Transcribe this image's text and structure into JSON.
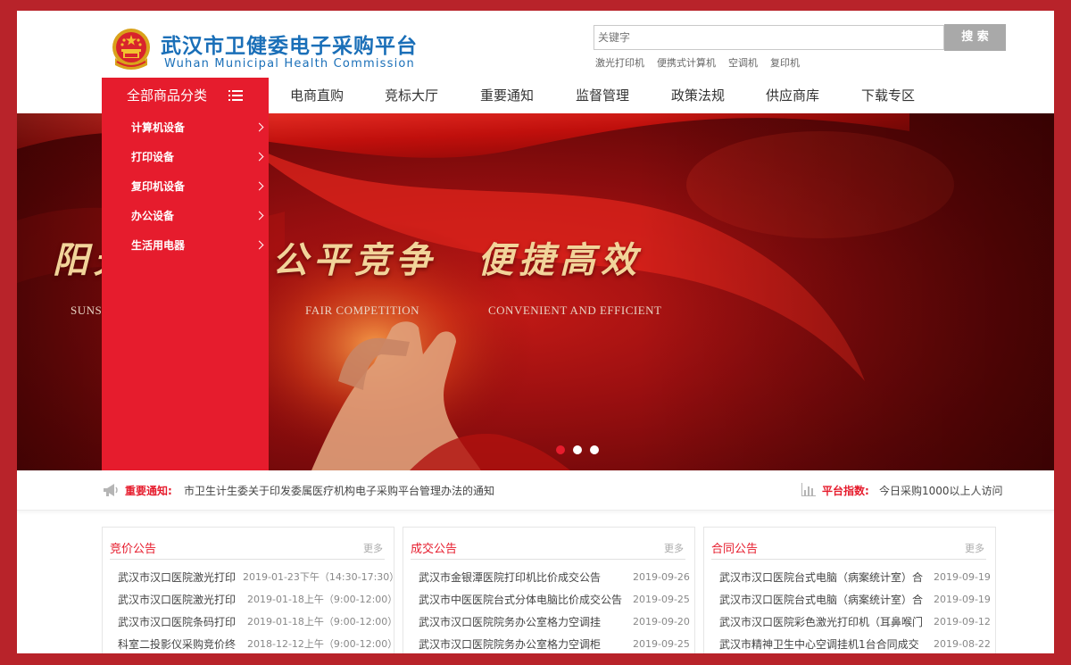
{
  "header": {
    "site_title": "武汉市卫健委电子采购平台",
    "site_subtitle": "Wuhan Municipal Health Commission",
    "search_placeholder": "关键字",
    "search_button": "搜 索",
    "hot_words": [
      "激光打印机",
      "便携式计算机",
      "空调机",
      "复印机"
    ]
  },
  "nav": {
    "category_label": "全部商品分类",
    "items": [
      "电商直购",
      "竞标大厅",
      "重要通知",
      "监督管理",
      "政策法规",
      "供应商库",
      "下载专区"
    ]
  },
  "categories": [
    "计算机设备",
    "打印设备",
    "复印机设备",
    "办公设备",
    "生活用电器"
  ],
  "banner": {
    "slogan_1": "阳光采购",
    "slogan_1_en": "SUNSHINE PROCUREMENT",
    "slogan_2": "公平竞争",
    "slogan_2_en": "FAIR COMPETITION",
    "slogan_3": "便捷高效",
    "slogan_3_en": "CONVENIENT AND EFFICIENT",
    "slide_count": 3,
    "active_slide": 1
  },
  "notice": {
    "label": "重要通知:",
    "text": "市卫生计生委关于印发委属医疗机构电子采购平台管理办法的通知",
    "index_label": "平台指数:",
    "index_text": "今日采购1000以上人访问"
  },
  "panels": [
    {
      "title": "竞价公告",
      "more": "更多",
      "rows": [
        {
          "title": "武汉市汉口医院激光打印",
          "date": "2019-01-23下午（14:30-17:30）"
        },
        {
          "title": "武汉市汉口医院激光打印",
          "date": "2019-01-18上午（9:00-12:00）"
        },
        {
          "title": "武汉市汉口医院条码打印",
          "date": "2019-01-18上午（9:00-12:00）"
        },
        {
          "title": "科室二投影仪采购竞价终",
          "date": "2018-12-12上午（9:00-12:00）"
        }
      ]
    },
    {
      "title": "成交公告",
      "more": "更多",
      "rows": [
        {
          "title": "武汉市金银潭医院打印机比价成交公告",
          "date": "2019-09-26"
        },
        {
          "title": "武汉市中医医院台式分体电脑比价成交公告",
          "date": "2019-09-25"
        },
        {
          "title": "武汉市汉口医院院务办公室格力空调挂",
          "date": "2019-09-20"
        },
        {
          "title": "武汉市汉口医院院务办公室格力空调柜",
          "date": "2019-09-25"
        }
      ]
    },
    {
      "title": "合同公告",
      "more": "更多",
      "rows": [
        {
          "title": "武汉市汉口医院台式电脑（病案统计室）合",
          "date": "2019-09-19"
        },
        {
          "title": "武汉市汉口医院台式电脑（病案统计室）合",
          "date": "2019-09-19"
        },
        {
          "title": "武汉市汉口医院彩色激光打印机（耳鼻喉门",
          "date": "2019-09-12"
        },
        {
          "title": "武汉市精神卫生中心空调挂机1台合同成交",
          "date": "2019-08-22"
        }
      ]
    }
  ],
  "colors": {
    "brand_red": "#e61c2d",
    "frame_red": "#b8232a",
    "title_blue": "#1a6fb8"
  },
  "icons": [
    "national-emblem-icon",
    "menu-list-icon",
    "chevron-right-icon",
    "megaphone-icon",
    "bar-chart-icon"
  ]
}
